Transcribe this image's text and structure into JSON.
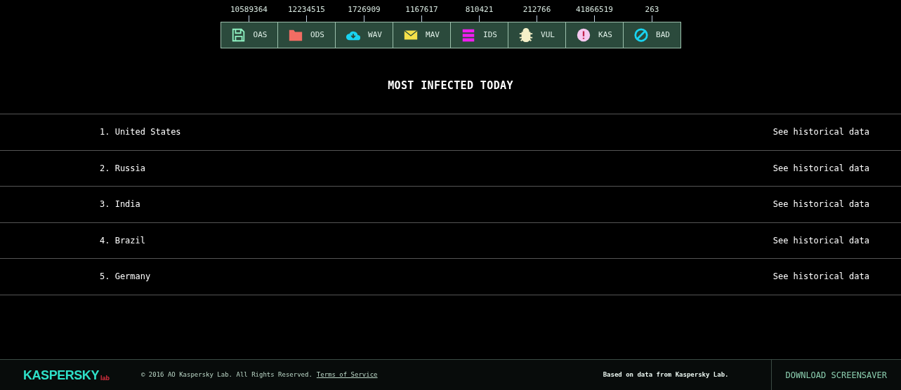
{
  "legend": [
    {
      "count": "10589364",
      "label": "OAS",
      "kind": "disk",
      "color": "#8ef0c0"
    },
    {
      "count": "12234515",
      "label": "ODS",
      "kind": "folder",
      "color": "#f26d63"
    },
    {
      "count": "1726909",
      "label": "WAV",
      "kind": "cloud",
      "color": "#19d3f0"
    },
    {
      "count": "1167617",
      "label": "MAV",
      "kind": "mail",
      "color": "#f5e04a"
    },
    {
      "count": "810421",
      "label": "IDS",
      "kind": "stack",
      "color": "#f01ef0"
    },
    {
      "count": "212766",
      "label": "VUL",
      "kind": "bug",
      "color": "#f5f0c8"
    },
    {
      "count": "41866519",
      "label": "KAS",
      "kind": "alert",
      "color": "#f5c8f0"
    },
    {
      "count": "263",
      "label": "BAD",
      "kind": "ban",
      "color": "#19d3f0"
    }
  ],
  "heading": "MOST INFECTED TODAY",
  "countries": [
    {
      "rank": "1.",
      "name": "United States",
      "link": "See historical data"
    },
    {
      "rank": "2.",
      "name": "Russia",
      "link": "See historical data"
    },
    {
      "rank": "3.",
      "name": "India",
      "link": "See historical data"
    },
    {
      "rank": "4.",
      "name": "Brazil",
      "link": "See historical data"
    },
    {
      "rank": "5.",
      "name": "Germany",
      "link": "See historical data"
    }
  ],
  "footer": {
    "logo": "KASPERSKY",
    "logo_tag": "lab",
    "copyright": "© 2016 AO Kaspersky Lab. All Rights Reserved.",
    "terms": "Terms of Service",
    "source": "Based on data from Kaspersky Lab.",
    "download": "DOWNLOAD SCREENSAVER"
  }
}
